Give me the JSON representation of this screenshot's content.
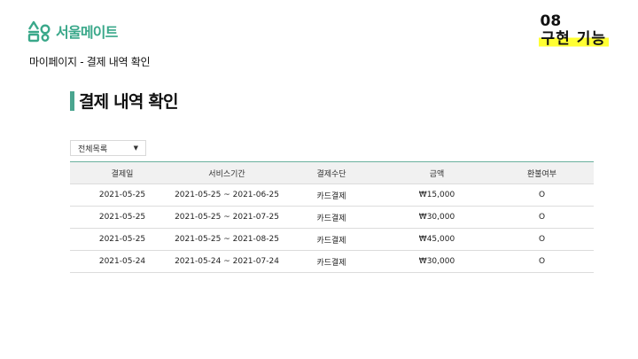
{
  "brand": {
    "name": "서울메이트",
    "accent": "#3aa88a"
  },
  "breadcrumb": "마이페이지 - 결제 내역 확인",
  "section_badge": {
    "number": "08",
    "title": "구현 기능",
    "highlight": "#ffff33"
  },
  "page_title": "결제 내역 확인",
  "filter": {
    "selected": "전체목록",
    "icon": "chevron-down-icon"
  },
  "table": {
    "headers": [
      "결제일",
      "서비스기간",
      "결제수단",
      "금액",
      "환불여부"
    ],
    "rows": [
      [
        "2021-05-25",
        "2021-05-25 ~ 2021-06-25",
        "카드결제",
        "₩15,000",
        "O"
      ],
      [
        "2021-05-25",
        "2021-05-25 ~ 2021-07-25",
        "카드결제",
        "₩30,000",
        "O"
      ],
      [
        "2021-05-25",
        "2021-05-25 ~ 2021-08-25",
        "카드결제",
        "₩45,000",
        "O"
      ],
      [
        "2021-05-24",
        "2021-05-24 ~ 2021-07-24",
        "카드결제",
        "₩30,000",
        "O"
      ]
    ]
  }
}
